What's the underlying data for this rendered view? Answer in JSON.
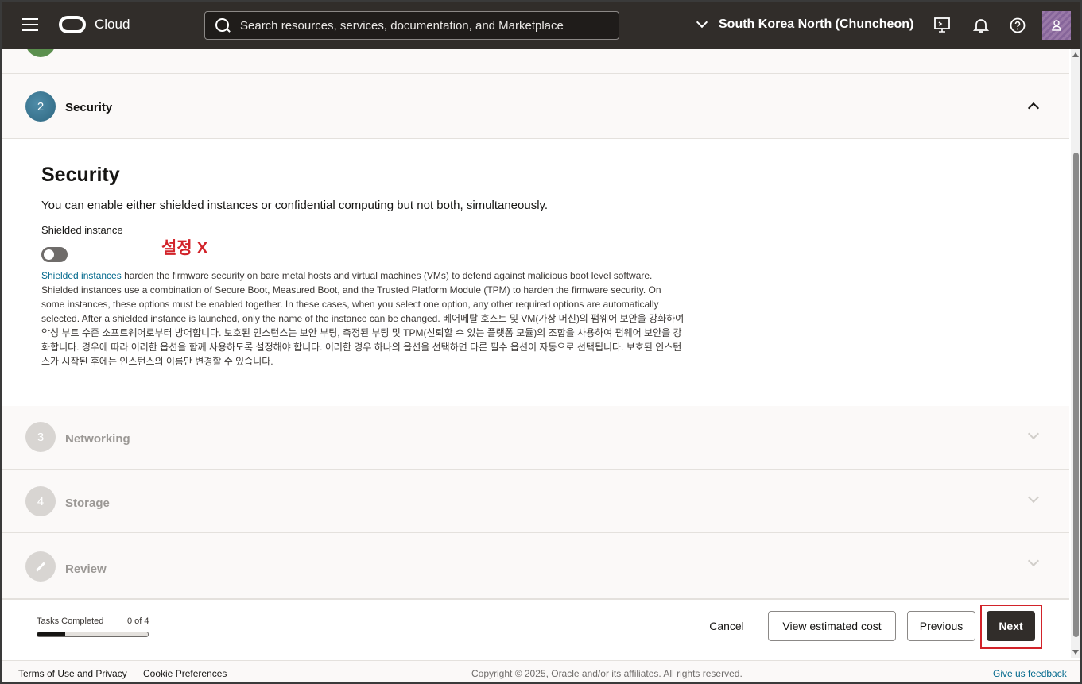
{
  "header": {
    "brand": "Cloud",
    "search_placeholder": "Search resources, services, documentation, and Marketplace",
    "region": "South Korea North (Chuncheon)"
  },
  "steps": {
    "security": {
      "number": "2",
      "title": "Security"
    },
    "networking": {
      "number": "3",
      "title": "Networking"
    },
    "storage": {
      "number": "4",
      "title": "Storage"
    },
    "review": {
      "title": "Review"
    }
  },
  "security_panel": {
    "heading": "Security",
    "description": "You can enable either shielded instances or confidential computing but not both, simultaneously.",
    "shielded_label": "Shielded instance",
    "annotation": "설정 X",
    "help_link": "Shielded instances",
    "help_text": " harden the firmware security on bare metal hosts and virtual machines (VMs) to defend against malicious boot level software. Shielded instances use a combination of Secure Boot, Measured Boot, and the Trusted Platform Module (TPM) to harden the firmware security. On some instances, these options must be enabled together. In these cases, when you select one option, any other required options are automatically selected. After a shielded instance is launched, only the name of the instance can be changed. 베어메탈 호스트 및 VM(가상 머신)의 펌웨어 보안을 강화하여 악성 부트 수준 소프트웨어로부터 방어합니다. 보호된 인스턴스는 보안 부팅, 측정된 부팅 및 TPM(신뢰할 수 있는 플랫폼 모듈)의 조합을 사용하여 펌웨어 보안을 강화합니다. 경우에 따라 이러한 옵션을 함께 사용하도록 설정해야 합니다. 이러한 경우 하나의 옵션을 선택하면 다른 필수 옵션이 자동으로 선택됩니다. 보호된 인스턴스가 시작된 후에는 인스턴스의 이름만 변경할 수 있습니다.",
    "shielded_enabled": false
  },
  "wizard_footer": {
    "tasks_label": "Tasks Completed",
    "tasks_count": "0 of 4",
    "progress_fraction": 0.25,
    "cancel": "Cancel",
    "view_cost": "View estimated cost",
    "previous": "Previous",
    "next": "Next"
  },
  "page_footer": {
    "terms": "Terms of Use and Privacy",
    "cookies": "Cookie Preferences",
    "copyright": "Copyright © 2025, Oracle and/or its affiliates. All rights reserved.",
    "feedback": "Give us feedback"
  },
  "colors": {
    "topbar": "#312d2a",
    "accent_link": "#00688c",
    "annotation_red": "#d2232a"
  },
  "icons": [
    "hamburger-icon",
    "oracle-logo",
    "search-icon",
    "chevron-down-icon",
    "cloud-shell-icon",
    "bell-icon",
    "help-icon",
    "user-avatar-icon",
    "pencil-icon"
  ]
}
